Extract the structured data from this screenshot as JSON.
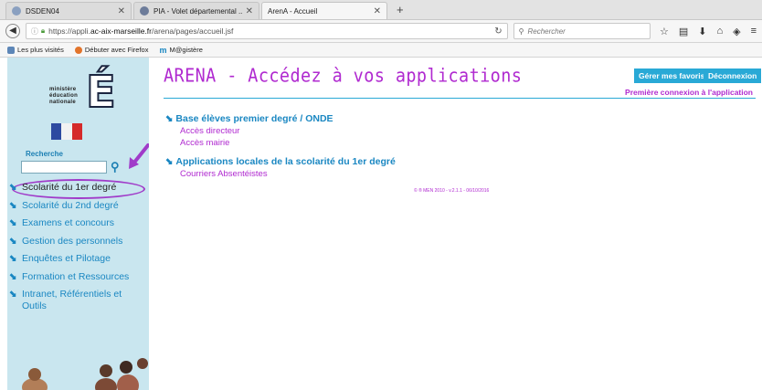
{
  "browser": {
    "tabs": [
      {
        "title": "DSDEN04",
        "active": false
      },
      {
        "title": "PIA - Volet départemental ...",
        "active": false
      },
      {
        "title": "ArenA - Accueil",
        "active": true
      }
    ],
    "newtab": "+",
    "url_prefix": "https://appli.",
    "url_domain": "ac-aix-marseille.fr",
    "url_path": "/arena/pages/accueil.jsf",
    "search_placeholder": "Rechercher",
    "bookmarks": [
      "Les plus visités",
      "Débuter avec Firefox",
      "M@gistère"
    ]
  },
  "sidebar": {
    "logo_text": "ministère\néducation\nnationale",
    "logo_letter": "É",
    "search_label": "Recherche",
    "search_value": "",
    "menu": [
      {
        "label": "Scolarité du 1er degré"
      },
      {
        "label": "Scolarité du 2nd degré"
      },
      {
        "label": "Examens et concours"
      },
      {
        "label": "Gestion des personnels"
      },
      {
        "label": "Enquêtes et Pilotage"
      },
      {
        "label": "Formation et Ressources"
      },
      {
        "label": "Intranet, Référentiels et Outils"
      }
    ]
  },
  "main": {
    "title": "ARENA - Accédez à vos applications",
    "btn_favoris": "Gérer mes favoris",
    "btn_deconnexion": "Déconnexion",
    "first_connection": "Première connexion à l'application",
    "sections": [
      {
        "title": "Base élèves premier degré / ONDE",
        "links": [
          "Accès directeur",
          "Accès mairie"
        ]
      },
      {
        "title": "Applications locales de la scolarité du 1er degré",
        "links": [
          "Courriers Absentéistes"
        ]
      }
    ],
    "footer": "© ® MEN 2010 - v.2.1.1 - 06/10/2016"
  },
  "colors": {
    "accent_blue": "#1a87c2",
    "accent_purple": "#b02ad0",
    "sidebar_bg": "#c9e6ef",
    "button_bg": "#29a9d6"
  }
}
